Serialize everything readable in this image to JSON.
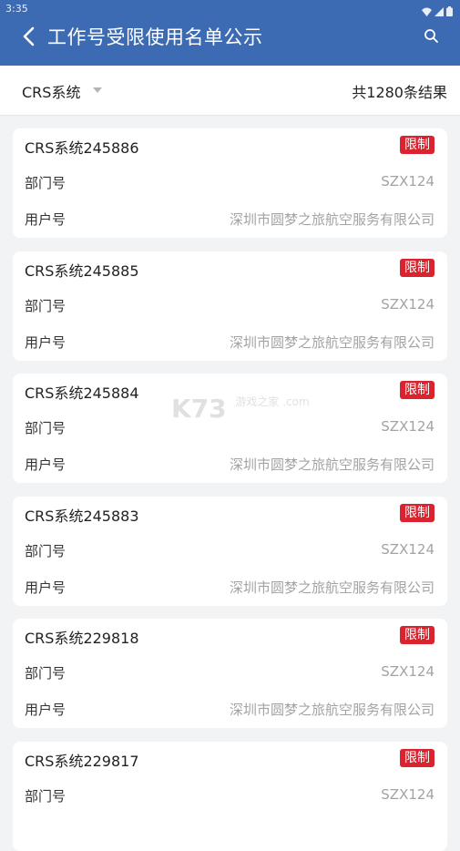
{
  "status_bar": {
    "time": "3:35"
  },
  "header": {
    "title": "工作号受限使用名单公示"
  },
  "filter": {
    "label": "CRS系统",
    "result_count": "共1280条结果"
  },
  "field_labels": {
    "dept": "部门号",
    "user": "用户号"
  },
  "records": [
    {
      "title": "CRS系统245886",
      "badge": "限制",
      "dept": "SZX124",
      "user": "深圳市圆梦之旅航空服务有限公司"
    },
    {
      "title": "CRS系统245885",
      "badge": "限制",
      "dept": "SZX124",
      "user": "深圳市圆梦之旅航空服务有限公司"
    },
    {
      "title": "CRS系统245884",
      "badge": "限制",
      "dept": "SZX124",
      "user": "深圳市圆梦之旅航空服务有限公司"
    },
    {
      "title": "CRS系统245883",
      "badge": "限制",
      "dept": "SZX124",
      "user": "深圳市圆梦之旅航空服务有限公司"
    },
    {
      "title": "CRS系统229818",
      "badge": "限制",
      "dept": "SZX124",
      "user": "深圳市圆梦之旅航空服务有限公司"
    },
    {
      "title": "CRS系统229817",
      "badge": "限制",
      "dept": "SZX124",
      "user": ""
    }
  ],
  "watermark": {
    "main": "K73",
    "sub": "游戏之家 .com"
  },
  "colors": {
    "header_bg": "#3d6bb3",
    "badge": "#d9232e",
    "page_bg": "#f2f3f5"
  }
}
